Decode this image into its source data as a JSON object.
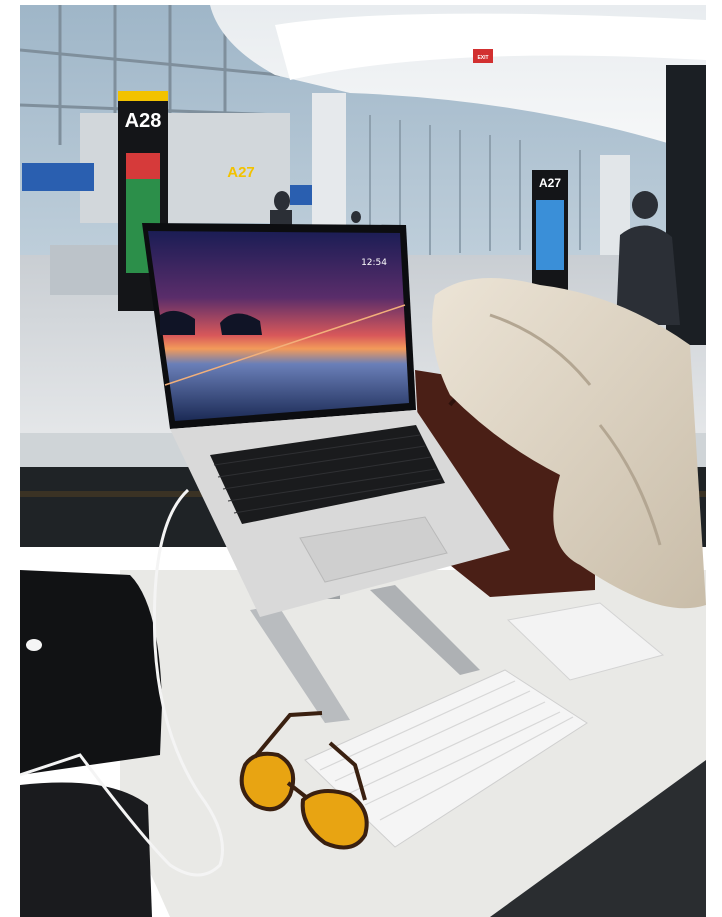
{
  "signs": {
    "gate_left": "A28",
    "gate_mid": "A27",
    "gate_right": "A27",
    "exit": "EXIT"
  },
  "laptop": {
    "clock": "12:54"
  },
  "colors": {
    "sign_yellow": "#f2c200",
    "glasses_lens": "#e8a412",
    "desk": "#e9e9e6",
    "laptop_silver": "#d9d9d9"
  }
}
